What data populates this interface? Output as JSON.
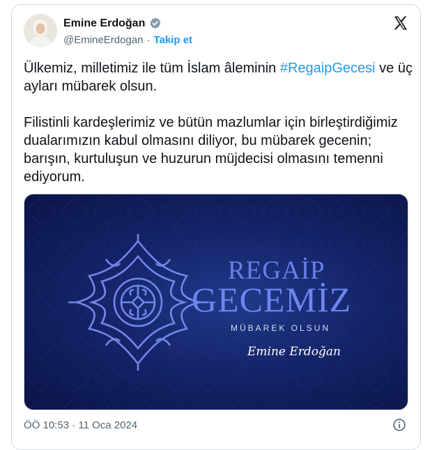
{
  "author": {
    "name": "Emine Erdoğan",
    "handle": "@EmineErdogan",
    "separator": "·",
    "follow_label": "Takip et"
  },
  "tweet": {
    "line1_before": "Ülkemiz, milletimiz ile tüm İslam âleminin ",
    "hashtag": "#RegaipGecesi",
    "line1_after": " ve üç ayları mübarek olsun.",
    "paragraph2": "Filistinli kardeşlerimiz ve bütün mazlumlar için birleştirdiğimiz dualarımızın kabul olmasını diliyor, bu mübarek gecenin; barışın, kurtuluşun ve huzurun müjdecisi olmasını temenni ediyorum."
  },
  "media": {
    "title_line1": "REGAİP",
    "title_line2": "GECEMİZ",
    "subtitle": "MÜBAREK OLSUN",
    "signature": "Emine Erdoğan"
  },
  "footer": {
    "timestamp": "ÖÖ 10:53 · 11 Oca 2024"
  },
  "icons": {
    "verified": "verified-badge-icon",
    "brand": "x-logo-icon",
    "info": "info-icon"
  },
  "colors": {
    "accent": "#1d9bf0",
    "text": "#0f1419",
    "muted": "#536471",
    "media_background": "#14246a",
    "media_title": "#6f84ee"
  }
}
